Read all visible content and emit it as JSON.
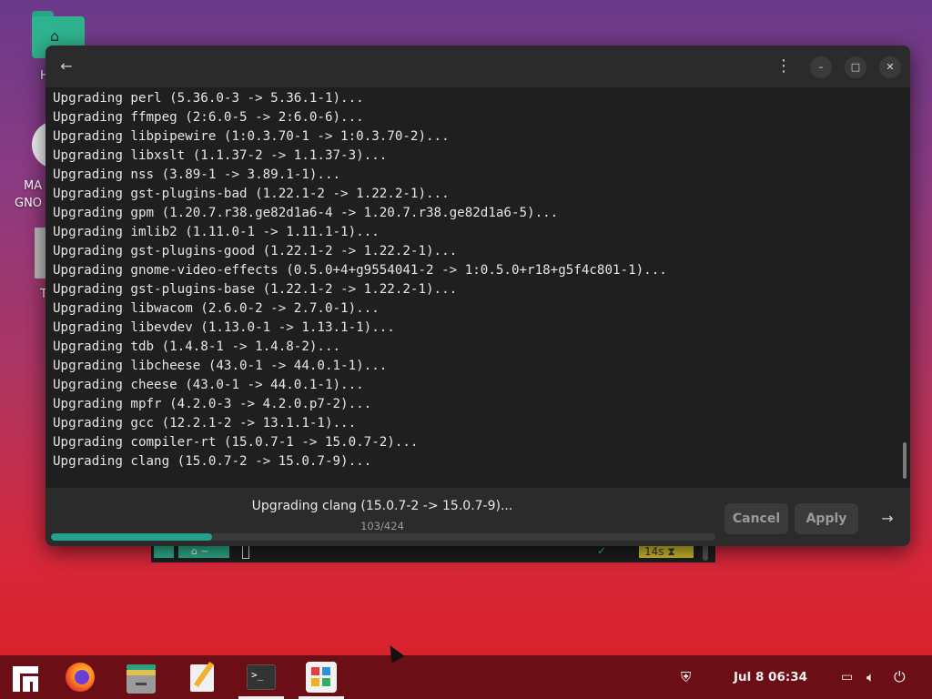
{
  "desktop": {
    "icons": [
      {
        "label": "H"
      },
      {
        "label_line1": "MA",
        "label_line2": "GNO"
      },
      {
        "label": "T"
      }
    ]
  },
  "background_terminal": {
    "home_glyph": "⌂ ~",
    "status_check": "✓",
    "elapsed": "14s ⧗"
  },
  "dialog": {
    "back_icon": "arrow-left-icon",
    "menu_icon": "kebab-icon",
    "window_controls": {
      "minimize": "–",
      "maximize": "□",
      "close": "✕"
    },
    "log_lines": [
      "Upgrading perl (5.36.0-3 -> 5.36.1-1)...",
      "Upgrading ffmpeg (2:6.0-5 -> 2:6.0-6)...",
      "Upgrading libpipewire (1:0.3.70-1 -> 1:0.3.70-2)...",
      "Upgrading libxslt (1.1.37-2 -> 1.1.37-3)...",
      "Upgrading nss (3.89-1 -> 3.89.1-1)...",
      "Upgrading gst-plugins-bad (1.22.1-2 -> 1.22.2-1)...",
      "Upgrading gpm (1.20.7.r38.ge82d1a6-4 -> 1.20.7.r38.ge82d1a6-5)...",
      "Upgrading imlib2 (1.11.0-1 -> 1.11.1-1)...",
      "Upgrading gst-plugins-good (1.22.1-2 -> 1.22.2-1)...",
      "Upgrading gnome-video-effects (0.5.0+4+g9554041-2 -> 1:0.5.0+r18+g5f4c801-1)...",
      "Upgrading gst-plugins-base (1.22.1-2 -> 1.22.2-1)...",
      "Upgrading libwacom (2.6.0-2 -> 2.7.0-1)...",
      "Upgrading libevdev (1.13.0-1 -> 1.13.1-1)...",
      "Upgrading tdb (1.4.8-1 -> 1.4.8-2)...",
      "Upgrading libcheese (43.0-1 -> 44.0.1-1)...",
      "Upgrading cheese (43.0-1 -> 44.0.1-1)...",
      "Upgrading mpfr (4.2.0-3 -> 4.2.0.p7-2)...",
      "Upgrading gcc (12.2.1-2 -> 13.1.1-1)...",
      "Upgrading compiler-rt (15.0.7-1 -> 15.0.7-2)...",
      "Upgrading clang (15.0.7-2 -> 15.0.7-9)..."
    ],
    "status": "Upgrading clang (15.0.7-2 -> 15.0.7-9)...",
    "progress_count": "103/424",
    "progress_fraction": 0.243,
    "cancel_label": "Cancel",
    "apply_label": "Apply",
    "next_icon": "arrow-right-icon"
  },
  "taskbar": {
    "apps": [
      "manjaro-menu-icon",
      "firefox-icon",
      "files-icon",
      "text-editor-icon",
      "terminal-icon",
      "software-icon"
    ],
    "clock": "Jul 8  06:34"
  },
  "colors": {
    "accent": "#26a189",
    "taskbar": "#6b0e15",
    "dialog_bg": "#2b2b2b",
    "log_bg": "#1f1f1f"
  }
}
